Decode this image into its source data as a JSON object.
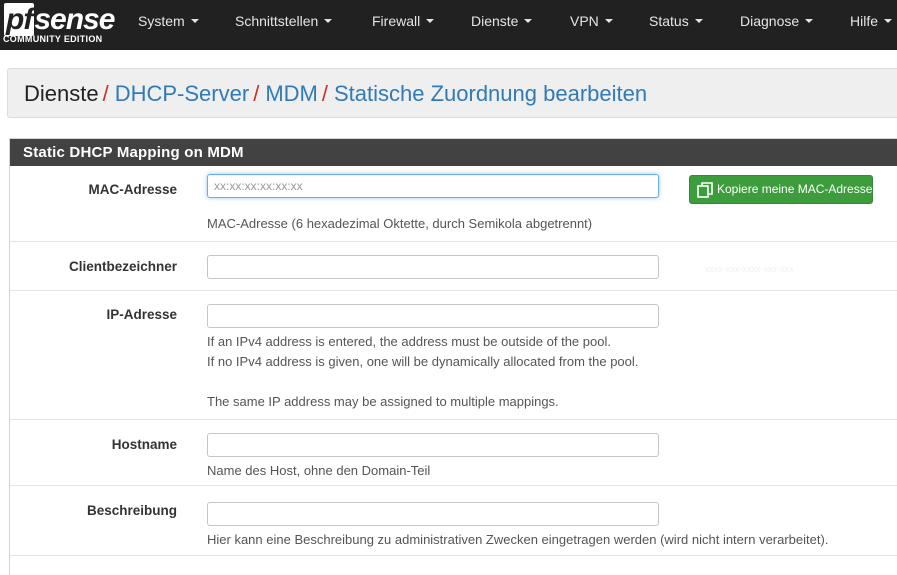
{
  "logo": {
    "main_pf": "pf",
    "main_rest": "sense",
    "edition": "COMMUNITY EDITION"
  },
  "nav": [
    "System",
    "Schnittstellen",
    "Firewall",
    "Dienste",
    "VPN",
    "Status",
    "Diagnose",
    "Hilfe"
  ],
  "breadcrumb": {
    "first": "Dienste",
    "sep": "/",
    "items": [
      "DHCP-Server",
      "MDM",
      "Statische Zuordnung bearbeiten"
    ]
  },
  "panel": {
    "title": "Static DHCP Mapping on MDM"
  },
  "mac": {
    "label": "MAC-Adresse",
    "placeholder": "xx:xx:xx:xx:xx:xx",
    "value": "",
    "copy_button": "Kopiere meine MAC-Adresse",
    "help": "MAC-Adresse (6 hexadezimal Oktette, durch Semikola abgetrennt)"
  },
  "client": {
    "label": "Clientbezeichner",
    "value": ""
  },
  "ip": {
    "label": "IP-Adresse",
    "value": "",
    "help1": "If an IPv4 address is entered, the address must be outside of the pool.",
    "help2": "If no IPv4 address is given, one will be dynamically allocated from the pool.",
    "help3": "The same IP address may be assigned to multiple mappings."
  },
  "hostname": {
    "label": "Hostname",
    "value": "",
    "help": "Name des Host, ohne den Domain-Teil"
  },
  "description": {
    "label": "Beschreibung",
    "value": "",
    "help": "Hier kann eine Beschreibung zu administrativen Zwecken eingetragen werden (wird nicht intern verarbeitet)."
  },
  "colors": {
    "navbar": "#212121",
    "heading": "#424242",
    "link": "#317ab8",
    "separator": "#c9302c",
    "button": "#3d9d3d"
  }
}
